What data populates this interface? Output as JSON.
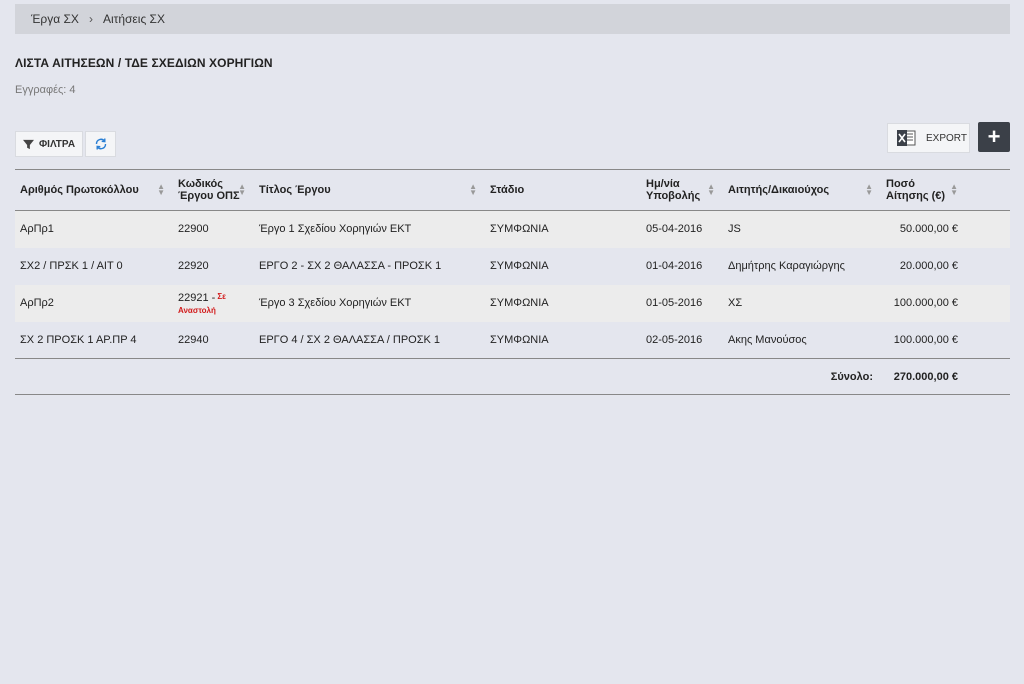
{
  "breadcrumb": {
    "item1": "Έργα ΣΧ",
    "separator": "›",
    "item2": "Αιτήσεις ΣΧ"
  },
  "page": {
    "title": "ΛΙΣΤΑ ΑΙΤΗΣΕΩΝ / ΤΔΕ ΣΧΕΔΙΩΝ ΧΟΡΗΓΙΩΝ",
    "record_count": "Εγγραφές: 4"
  },
  "toolbar": {
    "filters_label": "ΦΙΛΤΡΑ",
    "export_label": "EXPORT",
    "add_label": "+",
    "icons": {
      "filter": "filter-icon",
      "refresh": "refresh-icon",
      "excel": "excel-icon"
    }
  },
  "table": {
    "headers": {
      "protocol": "Αριθμός Πρωτοκόλλου",
      "ops_line1": "Κωδικός",
      "ops_line2": "Έργου ΟΠΣ",
      "title": "Τίτλος Έργου",
      "stage": "Στάδιο",
      "date_line1": "Ημ/νία",
      "date_line2": "Υποβολής",
      "applicant": "Αιτητής/Δικαιούχος",
      "amount_line1": "Ποσό",
      "amount_line2": "Αίτησης (€)"
    },
    "rows": [
      {
        "protocol": "ΑρΠρ1",
        "ops": "22900",
        "badge1": "",
        "badge2": "",
        "title": "Έργο 1 Σχεδίου Χορηγιών ΕΚΤ",
        "stage": "ΣΥΜΦΩΝΙΑ",
        "date": "05-04-2016",
        "applicant": "JS",
        "amount": "50.000,00 €"
      },
      {
        "protocol": "ΣΧ2 / ΠΡΣΚ 1 / ΑΙΤ 0",
        "ops": "22920",
        "badge1": "",
        "badge2": "",
        "title": "ΕΡΓΟ 2 - ΣΧ 2 ΘΑΛΑΣΣΑ - ΠΡΟΣΚ 1",
        "stage": "ΣΥΜΦΩΝΙΑ",
        "date": "01-04-2016",
        "applicant": "Δημήτρης Καραγιώργης",
        "amount": "20.000,00 €"
      },
      {
        "protocol": "ΑρΠρ2",
        "ops": "22921 -",
        "badge1": "Σε",
        "badge2": "Αναστολή",
        "title": "Έργο 3 Σχεδίου Χορηγιών ΕΚΤ",
        "stage": "ΣΥΜΦΩΝΙΑ",
        "date": "01-05-2016",
        "applicant": "ΧΣ",
        "amount": "100.000,00 €"
      },
      {
        "protocol": "ΣΧ 2 ΠΡΟΣΚ 1 ΑΡ.ΠΡ 4",
        "ops": "22940",
        "badge1": "",
        "badge2": "",
        "title": "ΕΡΓΟ 4 / ΣΧ 2 ΘΑΛΑΣΣΑ / ΠΡΟΣΚ 1",
        "stage": "ΣΥΜΦΩΝΙΑ",
        "date": "02-05-2016",
        "applicant": "Ακης Μανούσος",
        "amount": "100.000,00 €"
      }
    ],
    "footer": {
      "total_label": "Σύνολο:",
      "total_value": "270.000,00 €"
    }
  },
  "colors": {
    "background": "#e4e6ee",
    "breadcrumb_bg": "#d2d4da",
    "badge": "#d21b1b",
    "add_button": "#3b4048"
  }
}
